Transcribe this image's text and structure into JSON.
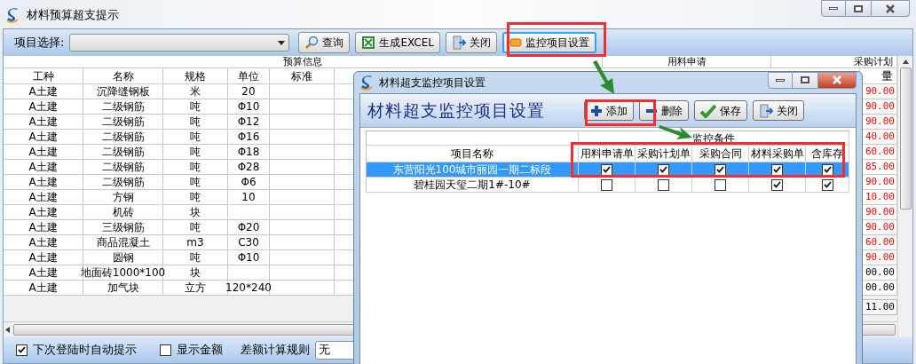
{
  "window": {
    "title": "材料预算超支提示"
  },
  "toolbar": {
    "project_label": "项目选择:",
    "buttons": [
      {
        "kind": "search",
        "label": "查询"
      },
      {
        "kind": "excel",
        "label": "生成EXCEL"
      },
      {
        "kind": "close",
        "label": "关闭"
      },
      {
        "kind": "settings",
        "label": "监控项目设置"
      }
    ]
  },
  "table": {
    "groups": [
      {
        "label": "预算信息",
        "kind": "left"
      },
      {
        "label": "用料申请",
        "kind": "mid"
      },
      {
        "label": "采购计划",
        "kind": "right"
      }
    ],
    "columns": [
      "工种",
      "名称",
      "规格",
      "单位",
      "标准"
    ],
    "last_column": "量",
    "rows": [
      {
        "cells": [
          "A土建",
          "沉降缝钢板",
          "米",
          "20",
          ""
        ],
        "amount": "90.00",
        "over": true
      },
      {
        "cells": [
          "A土建",
          "二级钢筋",
          "吨",
          "Φ10",
          ""
        ],
        "amount": "90.00",
        "over": true
      },
      {
        "cells": [
          "A土建",
          "二级钢筋",
          "吨",
          "Φ12",
          ""
        ],
        "amount": "90.00",
        "over": true
      },
      {
        "cells": [
          "A土建",
          "二级钢筋",
          "吨",
          "Φ16",
          ""
        ],
        "amount": "40.00",
        "over": true
      },
      {
        "cells": [
          "A土建",
          "二级钢筋",
          "吨",
          "Φ18",
          ""
        ],
        "amount": "60.00",
        "over": true
      },
      {
        "cells": [
          "A土建",
          "二级钢筋",
          "吨",
          "Φ28",
          ""
        ],
        "amount": "85.00",
        "over": true
      },
      {
        "cells": [
          "A土建",
          "二级钢筋",
          "吨",
          "Φ6",
          ""
        ],
        "amount": "90.00",
        "over": true
      },
      {
        "cells": [
          "A土建",
          "方钢",
          "吨",
          "10",
          ""
        ],
        "amount": "10.00",
        "over": true
      },
      {
        "cells": [
          "A土建",
          "机砖",
          "块",
          "",
          ""
        ],
        "amount": "90.00",
        "over": true
      },
      {
        "cells": [
          "A土建",
          "三级钢筋",
          "吨",
          "Φ20",
          ""
        ],
        "amount": "90.00",
        "over": true
      },
      {
        "cells": [
          "A土建",
          "商品混凝土",
          "m3",
          "C30",
          ""
        ],
        "amount": "60.00",
        "over": true
      },
      {
        "cells": [
          "A土建",
          "圆钢",
          "吨",
          "Φ10",
          ""
        ],
        "amount": "90.00",
        "over": true
      },
      {
        "cells": [
          "A土建",
          "地面砖1000*100",
          "块",
          "",
          ""
        ],
        "amount": "00.00",
        "over": false
      },
      {
        "cells": [
          "A土建",
          "加气块",
          "立方",
          "120*240",
          ""
        ],
        "amount": "00.00",
        "over": false
      }
    ],
    "total": "11.00"
  },
  "footer": {
    "auto_prompt": {
      "label": "下次登陆时自动提示",
      "checked": true
    },
    "show_amount": {
      "label": "显示金额",
      "checked": false
    },
    "rule_label": "差额计算规则",
    "rule_value": "无"
  },
  "dialog": {
    "title": "材料超支监控项目设置",
    "heading": "材料超支监控项目设置",
    "buttons": [
      {
        "kind": "add",
        "label": "添加"
      },
      {
        "kind": "remove",
        "label": "删除"
      },
      {
        "kind": "save",
        "label": "保存"
      },
      {
        "kind": "close",
        "label": "关闭"
      }
    ],
    "group_label": "监控条件",
    "name_column": "项目名称",
    "columns": [
      "用料申请单",
      "采购计划单",
      "采购合同",
      "材料采购单",
      "含库存"
    ],
    "rows": [
      {
        "name": "东营阳光100城市丽园一期二标段",
        "selected": true,
        "checks": [
          true,
          true,
          true,
          true,
          true
        ]
      },
      {
        "name": "碧桂园天玺二期1#-10#",
        "selected": false,
        "checks": [
          false,
          false,
          false,
          true,
          true
        ]
      }
    ]
  }
}
